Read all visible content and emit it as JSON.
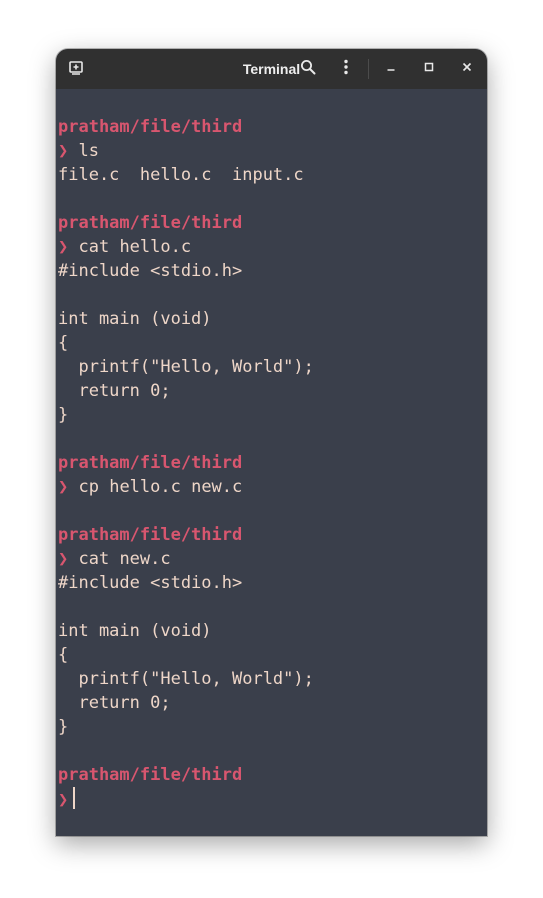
{
  "window": {
    "title": "Terminal"
  },
  "icons": {
    "new_tab": "new-tab-icon",
    "search": "search-icon",
    "menu": "menu-icon",
    "minimize": "minimize-icon",
    "maximize": "maximize-icon",
    "close": "close-icon"
  },
  "colors": {
    "terminal_bg": "#3a3f4b",
    "titlebar_bg": "#303030",
    "prompt_path": "#d8566f",
    "text": "#eed6c8"
  },
  "terminal": {
    "prompt_symbol": "❯",
    "blocks": [
      {
        "path": "pratham/file/third",
        "command": "ls",
        "output": [
          "file.c  hello.c  input.c"
        ]
      },
      {
        "path": "pratham/file/third",
        "command": "cat hello.c",
        "output": [
          "#include <stdio.h>",
          "",
          "int main (void)",
          "{",
          "  printf(\"Hello, World\");",
          "  return 0;",
          "}"
        ]
      },
      {
        "path": "pratham/file/third",
        "command": "cp hello.c new.c",
        "output": []
      },
      {
        "path": "pratham/file/third",
        "command": "cat new.c",
        "output": [
          "#include <stdio.h>",
          "",
          "int main (void)",
          "{",
          "  printf(\"Hello, World\");",
          "  return 0;",
          "}"
        ]
      }
    ],
    "current_path": "pratham/file/third"
  }
}
